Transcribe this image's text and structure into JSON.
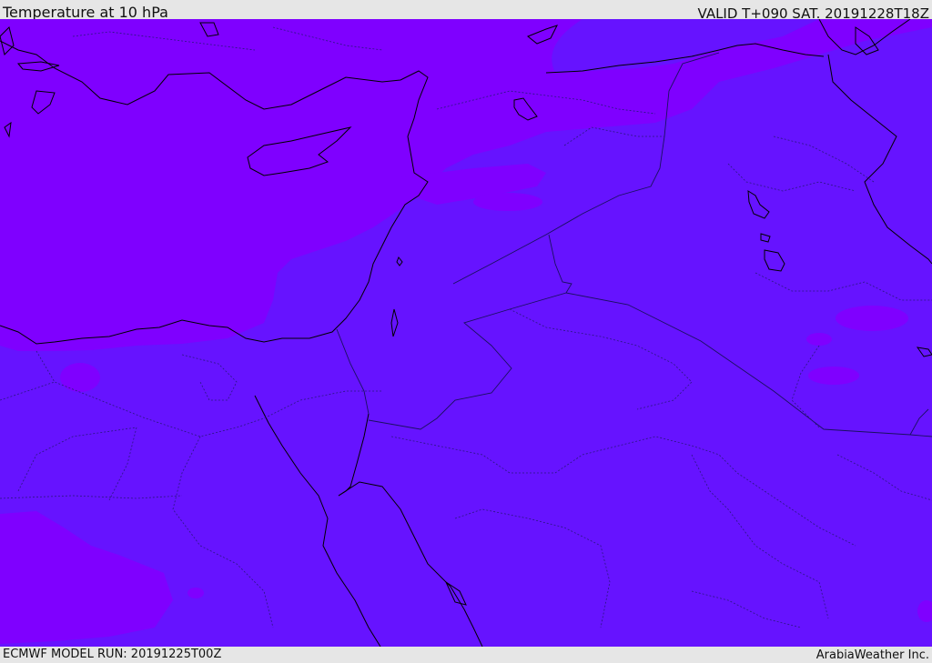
{
  "header": {
    "title": "Temperature at 10 hPa",
    "valid": "VALID T+090 SAT. 20191228T18Z"
  },
  "footer": {
    "model_run": "ECMWF MODEL RUN: 20191225T00Z",
    "credit": "ArabiaWeather Inc."
  },
  "colors": {
    "band_violet": "#7f00ff",
    "band_indigo": "#6613ff",
    "coastline": "#000000",
    "border": "#1a1060",
    "frame": "#e6e6e6"
  }
}
